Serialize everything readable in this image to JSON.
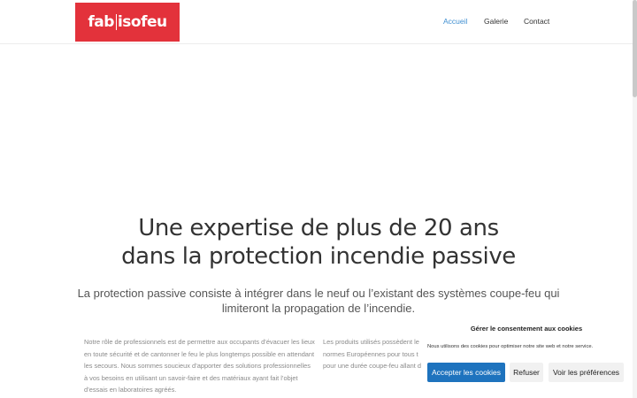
{
  "header": {
    "logo_left": "fab",
    "logo_right": "isofeu",
    "nav": [
      {
        "label": "Accueil",
        "active": true
      },
      {
        "label": "Galerie",
        "active": false
      },
      {
        "label": "Contact",
        "active": false
      }
    ]
  },
  "hero": {
    "title_line1": "Une expertise de plus de 20 ans",
    "title_line2": "dans la protection incendie passive",
    "subtitle_line1": "La protection passive consiste à intégrer dans le neuf ou l’existant des systèmes coupe-feu qui",
    "subtitle_line2": "limiteront la propagation de l’incendie."
  },
  "columns": {
    "col1": [
      "Notre rôle de professionnels est de permettre aux occupants d’évacuer les lieux",
      "en toute sécurité et de cantonner le feu le plus longtemps possible en attendant",
      "les secours. Nous sommes soucieux d’apporter des solutions professionnelles",
      "à vos besoins en utilisant un savoir-faire et des matériaux ayant fait l’objet",
      "d’essais en laboratoires agréés."
    ],
    "col2": [
      "Les produits utilisés possèdent le",
      "normes Européennes pour tous t",
      "pour une durée coupe-feu allant d"
    ]
  },
  "cookie": {
    "title": "Gérer le consentement aux cookies",
    "text": "Nous utilisons des cookies pour optimiser notre site web et notre service.",
    "accept": "Accepter les cookies",
    "refuse": "Refuser",
    "prefs": "Voir les préférences"
  },
  "colors": {
    "brand": "#e3323b",
    "nav_active": "#3f8fd1",
    "accept_button": "#1e73be"
  }
}
